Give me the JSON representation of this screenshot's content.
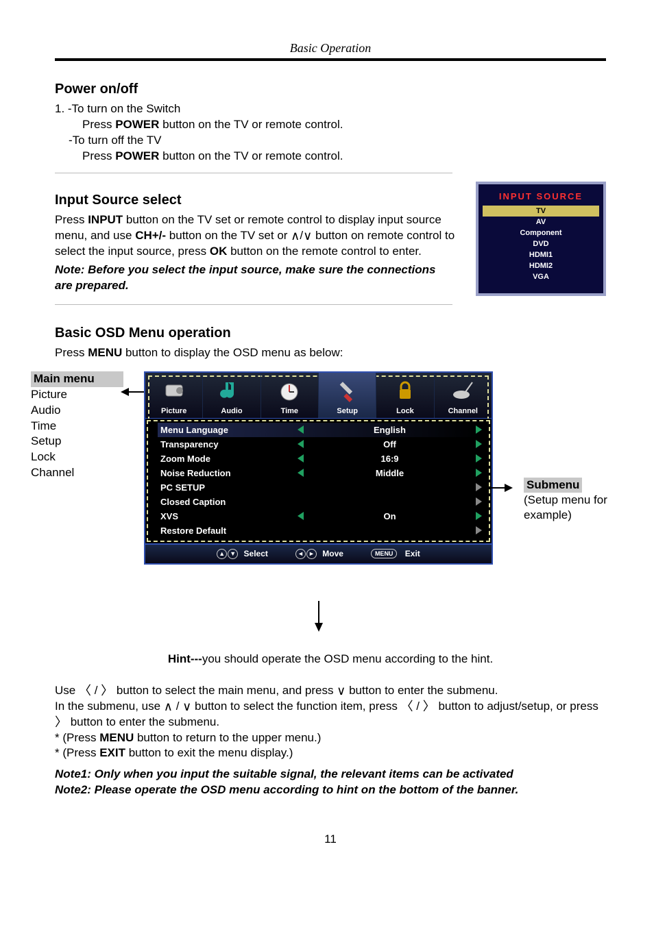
{
  "header": {
    "section": "Basic Operation"
  },
  "power": {
    "heading": "Power on/off",
    "l1": "1. -To turn on the Switch",
    "l2_pre": "Press ",
    "l2_btn": "POWER",
    "l2_post": " button on the TV or remote control.",
    "l3": "-To turn off the TV",
    "l4_pre": "Press ",
    "l4_btn": "POWER",
    "l4_post": " button on the TV or remote control."
  },
  "input": {
    "heading": "Input Source select",
    "p1a": "Press ",
    "p1b": "INPUT",
    "p1c": " button on the TV set or remote control to display input source menu, and use ",
    "p1d": "CH+/-",
    "p1e": " button on the TV set or ",
    "p1f": " button on remote control to select the input source, press ",
    "p1g": "OK",
    "p1h": " button on the remote control to enter.",
    "note": "Note: Before you select the input source, make sure the connections are prepared."
  },
  "source_panel": {
    "title": "INPUT SOURCE",
    "items": [
      "TV",
      "AV",
      "Component",
      "DVD",
      "HDMI1",
      "HDMI2",
      "VGA"
    ],
    "selected_index": 0
  },
  "osd": {
    "heading": "Basic OSD Menu operation",
    "intro_a": "Press ",
    "intro_b": "MENU",
    "intro_c": " button to display the OSD menu as below:",
    "mainmenu": {
      "title": "Main menu",
      "items": [
        "Picture",
        "Audio",
        "Time",
        "Setup",
        "Lock",
        "Channel"
      ]
    },
    "submenu": {
      "title": "Submenu",
      "note": "(Setup menu for example)"
    },
    "tabs": [
      {
        "label": "Picture"
      },
      {
        "label": "Audio"
      },
      {
        "label": "Time"
      },
      {
        "label": "Setup"
      },
      {
        "label": "Lock"
      },
      {
        "label": "Channel"
      }
    ],
    "active_tab": 3,
    "rows": [
      {
        "label": "Menu Language",
        "value": "English",
        "arrows": true
      },
      {
        "label": "Transparency",
        "value": "Off",
        "arrows": true
      },
      {
        "label": "Zoom Mode",
        "value": "16:9",
        "arrows": true
      },
      {
        "label": "Noise Reduction",
        "value": "Middle",
        "arrows": true
      },
      {
        "label": "PC SETUP",
        "value": "",
        "arrows": "right"
      },
      {
        "label": "Closed Caption",
        "value": "",
        "arrows": "right"
      },
      {
        "label": "XVS",
        "value": "On",
        "arrows": true
      },
      {
        "label": "Restore Default",
        "value": "",
        "arrows": "right"
      }
    ],
    "hint": {
      "select": "Select",
      "move": "Move",
      "exit": "Exit",
      "menu": "MENU"
    },
    "hint_line_a": "Hint---",
    "hint_line_b": "you should operate the OSD menu according to the hint."
  },
  "usage": {
    "p1a": "Use ",
    "p1b": " button to select the main menu, and press ",
    "p1c": " button to enter the submenu.",
    "p2a": "In the submenu, use ",
    "p2b": " button to select the function item, press ",
    "p2c": " button to adjust/setup, or press ",
    "p2d": " button to enter the submenu.",
    "p3a": "* (Press ",
    "p3b": "MENU",
    "p3c": " button to return to the upper menu.)",
    "p4a": "* (Press ",
    "p4b": "EXIT",
    "p4c": " button to exit the menu display.)",
    "note1": "Note1: Only when you input the suitable signal, the relevant items can be activated",
    "note2": "Note2: Please operate the OSD menu according to hint on the bottom of the banner."
  },
  "page_number": "11"
}
